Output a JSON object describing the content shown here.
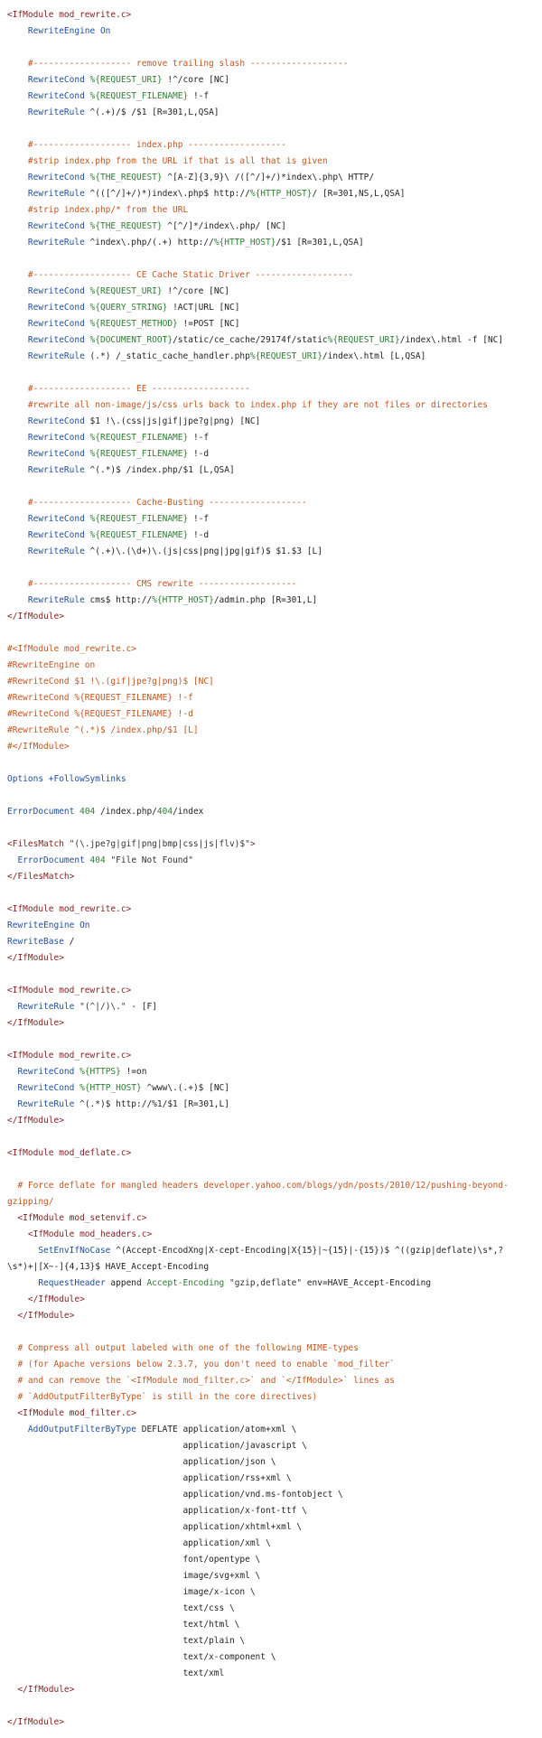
{
  "file": {
    "lines": [
      [
        [
          "tag",
          "<IfModule mod_rewrite.c>"
        ]
      ],
      [
        [
          "txt",
          "    "
        ],
        [
          "kw",
          "RewriteEngine On"
        ]
      ],
      [],
      [
        [
          "com",
          "    #------------------- remove trailing slash -------------------"
        ]
      ],
      [
        [
          "txt",
          "    "
        ],
        [
          "kw",
          "RewriteCond"
        ],
        [
          "txt",
          " "
        ],
        [
          "var",
          "%{REQUEST_URI}"
        ],
        [
          "txt",
          " !^/core [NC]"
        ]
      ],
      [
        [
          "txt",
          "    "
        ],
        [
          "kw",
          "RewriteCond"
        ],
        [
          "txt",
          " "
        ],
        [
          "var",
          "%{REQUEST_FILENAME}"
        ],
        [
          "txt",
          " !-f"
        ]
      ],
      [
        [
          "txt",
          "    "
        ],
        [
          "kw",
          "RewriteRule"
        ],
        [
          "txt",
          " ^(.+)/$ /$1 [R=301,L,QSA]"
        ]
      ],
      [],
      [
        [
          "com",
          "    #------------------- index.php -------------------"
        ]
      ],
      [
        [
          "com",
          "    #strip index.php from the URL if that is all that is given"
        ]
      ],
      [
        [
          "txt",
          "    "
        ],
        [
          "kw",
          "RewriteCond"
        ],
        [
          "txt",
          " "
        ],
        [
          "var",
          "%{THE_REQUEST}"
        ],
        [
          "txt",
          " ^[A-Z]{3,9}\\ /([^/]+/)*index\\.php\\ HTTP/"
        ]
      ],
      [
        [
          "txt",
          "    "
        ],
        [
          "kw",
          "RewriteRule"
        ],
        [
          "txt",
          " ^(([^/]+/)*)index\\.php$ http://"
        ],
        [
          "var",
          "%{HTTP_HOST}"
        ],
        [
          "txt",
          "/ [R=301,NS,L,QSA]"
        ]
      ],
      [
        [
          "com",
          "    #strip index.php/* from the URL"
        ]
      ],
      [
        [
          "txt",
          "    "
        ],
        [
          "kw",
          "RewriteCond"
        ],
        [
          "txt",
          " "
        ],
        [
          "var",
          "%{THE_REQUEST}"
        ],
        [
          "txt",
          " ^[^/]*/index\\.php/ [NC]"
        ]
      ],
      [
        [
          "txt",
          "    "
        ],
        [
          "kw",
          "RewriteRule"
        ],
        [
          "txt",
          " ^index\\.php/(.+) http://"
        ],
        [
          "var",
          "%{HTTP_HOST}"
        ],
        [
          "txt",
          "/$1 [R=301,L,QSA]"
        ]
      ],
      [],
      [
        [
          "com",
          "    #------------------- CE Cache Static Driver -------------------"
        ]
      ],
      [
        [
          "txt",
          "    "
        ],
        [
          "kw",
          "RewriteCond"
        ],
        [
          "txt",
          " "
        ],
        [
          "var",
          "%{REQUEST_URI}"
        ],
        [
          "txt",
          " !^/core [NC]"
        ]
      ],
      [
        [
          "txt",
          "    "
        ],
        [
          "kw",
          "RewriteCond"
        ],
        [
          "txt",
          " "
        ],
        [
          "var",
          "%{QUERY_STRING}"
        ],
        [
          "txt",
          " !ACT|URL [NC]"
        ]
      ],
      [
        [
          "txt",
          "    "
        ],
        [
          "kw",
          "RewriteCond"
        ],
        [
          "txt",
          " "
        ],
        [
          "var",
          "%{REQUEST_METHOD}"
        ],
        [
          "txt",
          " !=POST [NC]"
        ]
      ],
      [
        [
          "txt",
          "    "
        ],
        [
          "kw",
          "RewriteCond"
        ],
        [
          "txt",
          " "
        ],
        [
          "var",
          "%{DOCUMENT_ROOT}"
        ],
        [
          "txt",
          "/static/ce_cache/29174f/static"
        ],
        [
          "var",
          "%{REQUEST_URI}"
        ],
        [
          "txt",
          "/index\\.html -f [NC]"
        ]
      ],
      [
        [
          "txt",
          "    "
        ],
        [
          "kw",
          "RewriteRule"
        ],
        [
          "txt",
          " (.*) /_static_cache_handler.php"
        ],
        [
          "var",
          "%{REQUEST_URI}"
        ],
        [
          "txt",
          "/index\\.html [L,QSA]"
        ]
      ],
      [],
      [
        [
          "com",
          "    #------------------- EE -------------------"
        ]
      ],
      [
        [
          "com",
          "    #rewrite all non-image/js/css urls back to index.php if they are not files or directories"
        ]
      ],
      [
        [
          "txt",
          "    "
        ],
        [
          "kw",
          "RewriteCond"
        ],
        [
          "txt",
          " $1 !\\.(css|js|gif|jpe?g|png) [NC]"
        ]
      ],
      [
        [
          "txt",
          "    "
        ],
        [
          "kw",
          "RewriteCond"
        ],
        [
          "txt",
          " "
        ],
        [
          "var",
          "%{REQUEST_FILENAME}"
        ],
        [
          "txt",
          " !-f"
        ]
      ],
      [
        [
          "txt",
          "    "
        ],
        [
          "kw",
          "RewriteCond"
        ],
        [
          "txt",
          " "
        ],
        [
          "var",
          "%{REQUEST_FILENAME}"
        ],
        [
          "txt",
          " !-d"
        ]
      ],
      [
        [
          "txt",
          "    "
        ],
        [
          "kw",
          "RewriteRule"
        ],
        [
          "txt",
          " ^(.*)$ /index.php/$1 [L,QSA]"
        ]
      ],
      [],
      [
        [
          "com",
          "    #------------------- Cache-Busting -------------------"
        ]
      ],
      [
        [
          "txt",
          "    "
        ],
        [
          "kw",
          "RewriteCond"
        ],
        [
          "txt",
          " "
        ],
        [
          "var",
          "%{REQUEST_FILENAME}"
        ],
        [
          "txt",
          " !-f"
        ]
      ],
      [
        [
          "txt",
          "    "
        ],
        [
          "kw",
          "RewriteCond"
        ],
        [
          "txt",
          " "
        ],
        [
          "var",
          "%{REQUEST_FILENAME}"
        ],
        [
          "txt",
          " !-d"
        ]
      ],
      [
        [
          "txt",
          "    "
        ],
        [
          "kw",
          "RewriteRule"
        ],
        [
          "txt",
          " ^(.+)\\.(\\d+)\\.(js|css|png|jpg|gif)$ $1.$3 [L]"
        ]
      ],
      [],
      [
        [
          "com",
          "    #------------------- CMS rewrite -------------------"
        ]
      ],
      [
        [
          "txt",
          "    "
        ],
        [
          "kw",
          "RewriteRule"
        ],
        [
          "txt",
          " cms$ http://"
        ],
        [
          "var",
          "%{HTTP_HOST}"
        ],
        [
          "txt",
          "/admin.php [R=301,L]"
        ]
      ],
      [
        [
          "tag",
          "</IfModule>"
        ]
      ],
      [],
      [
        [
          "com",
          "#<IfModule mod_rewrite.c>"
        ]
      ],
      [
        [
          "com",
          "#RewriteEngine on"
        ]
      ],
      [
        [
          "com",
          "#RewriteCond $1 !\\.(gif|jpe?g|png)$ [NC]"
        ]
      ],
      [
        [
          "com",
          "#RewriteCond %{REQUEST_FILENAME} !-f"
        ]
      ],
      [
        [
          "com",
          "#RewriteCond %{REQUEST_FILENAME} !-d"
        ]
      ],
      [
        [
          "com",
          "#RewriteRule ^(.*)$ /index.php/$1 [L]"
        ]
      ],
      [
        [
          "com",
          "#</IfModule>"
        ]
      ],
      [],
      [
        [
          "kw",
          "Options +FollowSymlinks"
        ]
      ],
      [],
      [
        [
          "kw",
          "ErrorDocument"
        ],
        [
          "txt",
          " "
        ],
        [
          "num",
          "404"
        ],
        [
          "txt",
          " /index.php/"
        ],
        [
          "num",
          "404"
        ],
        [
          "txt",
          "/index"
        ]
      ],
      [],
      [
        [
          "tag",
          "<FilesMatch"
        ],
        [
          "txt",
          " "
        ],
        [
          "str",
          "\"(\\.jpe?g|gif|png|bmp|css|js|flv)$\""
        ],
        [
          "tag",
          ">"
        ]
      ],
      [
        [
          "txt",
          "  "
        ],
        [
          "kw",
          "ErrorDocument"
        ],
        [
          "txt",
          " "
        ],
        [
          "num",
          "404"
        ],
        [
          "txt",
          " "
        ],
        [
          "str",
          "\"File Not Found\""
        ]
      ],
      [
        [
          "tag",
          "</FilesMatch>"
        ]
      ],
      [],
      [
        [
          "tag",
          "<IfModule mod_rewrite.c>"
        ]
      ],
      [
        [
          "kw",
          "RewriteEngine On"
        ]
      ],
      [
        [
          "kw",
          "RewriteBase"
        ],
        [
          "txt",
          " /"
        ]
      ],
      [
        [
          "tag",
          "</IfModule>"
        ]
      ],
      [],
      [
        [
          "tag",
          "<IfModule mod_rewrite.c>"
        ]
      ],
      [
        [
          "txt",
          "  "
        ],
        [
          "kw",
          "RewriteRule"
        ],
        [
          "txt",
          " "
        ],
        [
          "str",
          "\"(^|/)\\.\""
        ],
        [
          "txt",
          " - [F]"
        ]
      ],
      [
        [
          "tag",
          "</IfModule>"
        ]
      ],
      [],
      [
        [
          "tag",
          "<IfModule mod_rewrite.c>"
        ]
      ],
      [
        [
          "txt",
          "  "
        ],
        [
          "kw",
          "RewriteCond"
        ],
        [
          "txt",
          " "
        ],
        [
          "var",
          "%{HTTPS}"
        ],
        [
          "txt",
          " !=on"
        ]
      ],
      [
        [
          "txt",
          "  "
        ],
        [
          "kw",
          "RewriteCond"
        ],
        [
          "txt",
          " "
        ],
        [
          "var",
          "%{HTTP_HOST}"
        ],
        [
          "txt",
          " ^www\\.(.+)$ [NC]"
        ]
      ],
      [
        [
          "txt",
          "  "
        ],
        [
          "kw",
          "RewriteRule"
        ],
        [
          "txt",
          " ^(.*)$ http://%1/$1 [R=301,L]"
        ]
      ],
      [
        [
          "tag",
          "</IfModule>"
        ]
      ],
      [],
      [
        [
          "tag",
          "<IfModule mod_deflate.c>"
        ]
      ],
      [],
      [
        [
          "com",
          "  # Force deflate for mangled headers developer.yahoo.com/blogs/ydn/posts/2010/12/pushing-beyond-"
        ]
      ],
      [
        [
          "com",
          "gzipping/"
        ]
      ],
      [
        [
          "txt",
          "  "
        ],
        [
          "tag",
          "<IfModule mod_setenvif.c>"
        ]
      ],
      [
        [
          "txt",
          "    "
        ],
        [
          "tag",
          "<IfModule mod_headers.c>"
        ]
      ],
      [
        [
          "txt",
          "      "
        ],
        [
          "kw",
          "SetEnvIfNoCase"
        ],
        [
          "txt",
          " ^(Accept-EncodXng|X-cept-Encoding|X{15}|~{15}|-{15})$ ^((gzip|deflate)\\s*,?"
        ]
      ],
      [
        [
          "txt",
          "\\s*)+|[X~-]{4,13}$ HAVE_Accept-Encoding"
        ]
      ],
      [
        [
          "txt",
          "      "
        ],
        [
          "kw",
          "RequestHeader"
        ],
        [
          "txt",
          " append "
        ],
        [
          "var",
          "Accept-Encoding"
        ],
        [
          "txt",
          " "
        ],
        [
          "str",
          "\"gzip,deflate\""
        ],
        [
          "txt",
          " env=HAVE_Accept-Encoding"
        ]
      ],
      [
        [
          "txt",
          "    "
        ],
        [
          "tag",
          "</IfModule>"
        ]
      ],
      [
        [
          "txt",
          "  "
        ],
        [
          "tag",
          "</IfModule>"
        ]
      ],
      [],
      [
        [
          "com",
          "  # Compress all output labeled with one of the following MIME-types"
        ]
      ],
      [
        [
          "com",
          "  # (for Apache versions below 2.3.7, you don't need to enable `mod_filter`"
        ]
      ],
      [
        [
          "com",
          "  # and can remove the `<IfModule mod_filter.c>` and `</IfModule>` lines as"
        ]
      ],
      [
        [
          "com",
          "  # `AddOutputFilterByType` is still in the core directives)"
        ]
      ],
      [
        [
          "txt",
          "  "
        ],
        [
          "tag",
          "<IfModule mod_filter.c>"
        ]
      ],
      [
        [
          "txt",
          "    "
        ],
        [
          "kw",
          "AddOutputFilterByType"
        ],
        [
          "txt",
          " DEFLATE application/atom+xml \\"
        ]
      ],
      [
        [
          "txt",
          "                                  application/javascript \\"
        ]
      ],
      [
        [
          "txt",
          "                                  application/json \\"
        ]
      ],
      [
        [
          "txt",
          "                                  application/rss+xml \\"
        ]
      ],
      [
        [
          "txt",
          "                                  application/vnd.ms-fontobject \\"
        ]
      ],
      [
        [
          "txt",
          "                                  application/x-font-ttf \\"
        ]
      ],
      [
        [
          "txt",
          "                                  application/xhtml+xml \\"
        ]
      ],
      [
        [
          "txt",
          "                                  application/xml \\"
        ]
      ],
      [
        [
          "txt",
          "                                  font/opentype \\"
        ]
      ],
      [
        [
          "txt",
          "                                  image/svg+xml \\"
        ]
      ],
      [
        [
          "txt",
          "                                  image/x-icon \\"
        ]
      ],
      [
        [
          "txt",
          "                                  text/css \\"
        ]
      ],
      [
        [
          "txt",
          "                                  text/html \\"
        ]
      ],
      [
        [
          "txt",
          "                                  text/plain \\"
        ]
      ],
      [
        [
          "txt",
          "                                  text/x-component \\"
        ]
      ],
      [
        [
          "txt",
          "                                  text/xml"
        ]
      ],
      [
        [
          "txt",
          "  "
        ],
        [
          "tag",
          "</IfModule>"
        ]
      ],
      [],
      [
        [
          "tag",
          "</IfModule>"
        ]
      ]
    ]
  }
}
